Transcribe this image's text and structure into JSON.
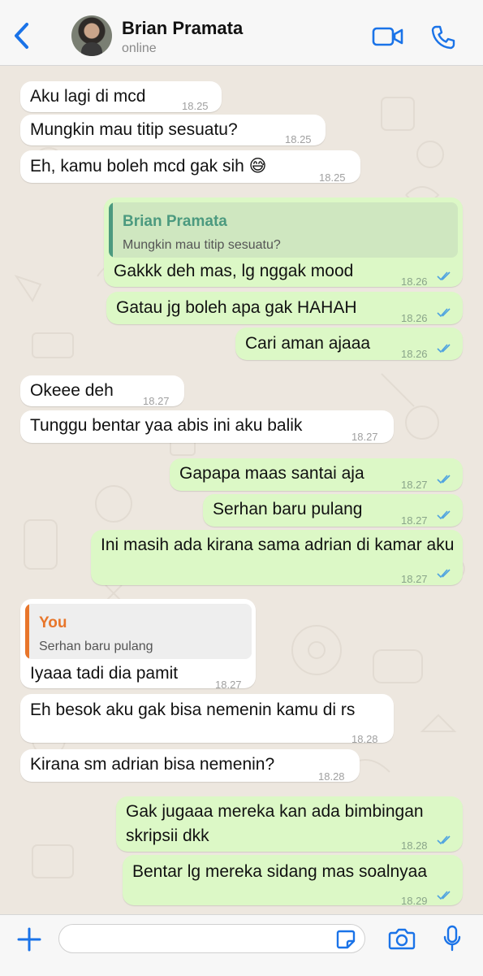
{
  "header": {
    "contact_name": "Brian Pramata",
    "status": "online",
    "accent_color": "#1a73e8",
    "icons": [
      "back-chevron-icon",
      "video-call-icon",
      "phone-call-icon"
    ]
  },
  "messages": [
    {
      "dir": "in",
      "text": "Aku lagi di mcd",
      "time": "18.25"
    },
    {
      "dir": "in",
      "text": "Mungkin mau titip sesuatu?",
      "time": "18.25"
    },
    {
      "dir": "in",
      "text": "Eh, kamu boleh mcd gak sih 😅",
      "time": "18.25"
    },
    {
      "dir": "out",
      "quote": {
        "name": "Brian Pramata",
        "text": "Mungkin mau titip sesuatu?"
      },
      "text": "Gakkk deh mas, lg nggak mood",
      "time": "18.26"
    },
    {
      "dir": "out",
      "text": "Gatau jg boleh apa gak HAHAH",
      "time": "18.26"
    },
    {
      "dir": "out",
      "text": "Cari aman ajaaa",
      "time": "18.26"
    },
    {
      "dir": "in",
      "text": "Okeee deh",
      "time": "18.27"
    },
    {
      "dir": "in",
      "text": "Tunggu bentar yaa abis ini aku balik",
      "time": "18.27"
    },
    {
      "dir": "out",
      "text": "Gapapa maas santai aja",
      "time": "18.27"
    },
    {
      "dir": "out",
      "text": "Serhan baru pulang",
      "time": "18.27"
    },
    {
      "dir": "out",
      "text": "Ini masih ada kirana sama adrian di kamar aku",
      "time": "18.27"
    },
    {
      "dir": "in",
      "quote": {
        "name": "You",
        "text": "Serhan baru pulang"
      },
      "text": "Iyaaa tadi dia pamit",
      "time": "18.27"
    },
    {
      "dir": "in",
      "text": "Eh besok aku gak bisa nemenin kamu di rs",
      "time": "18.28"
    },
    {
      "dir": "in",
      "text": "Kirana sm adrian bisa nemenin?",
      "time": "18.28"
    },
    {
      "dir": "out",
      "text": "Gak jugaaa mereka kan ada bimbingan skripsii dkk",
      "time": "18.28"
    },
    {
      "dir": "out",
      "text": "Bentar lg mereka sidang mas soalnyaa",
      "time": "18.29"
    }
  ],
  "colors": {
    "incoming_bubble": "#ffffff",
    "outgoing_bubble": "#dcf8c6",
    "read_tick": "#4fa3e0",
    "quote_incoming_accent": "#4c9a7f",
    "quote_outgoing_accent": "#e8762b"
  },
  "composer": {
    "value": "",
    "icons": [
      "plus-icon",
      "sticker-icon",
      "camera-icon",
      "microphone-icon"
    ]
  }
}
